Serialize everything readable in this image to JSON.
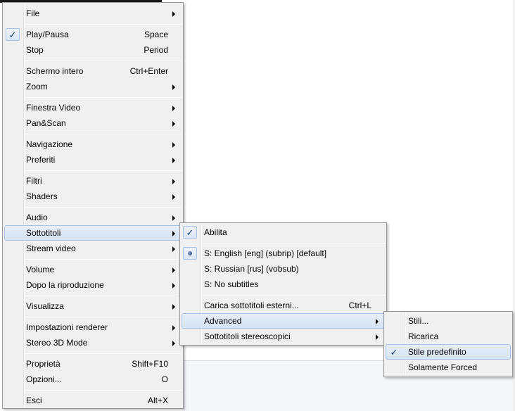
{
  "main_menu": {
    "items": [
      {
        "label": "File",
        "submenu": true
      },
      {
        "label": "Play/Pausa",
        "shortcut": "Space",
        "checked": true
      },
      {
        "label": "Stop",
        "shortcut": "Period"
      },
      {
        "label": "Schermo intero",
        "shortcut": "Ctrl+Enter"
      },
      {
        "label": "Zoom",
        "submenu": true
      },
      {
        "label": "Finestra Video",
        "submenu": true
      },
      {
        "label": "Pan&Scan",
        "submenu": true
      },
      {
        "label": "Navigazione",
        "submenu": true
      },
      {
        "label": "Preferiti",
        "submenu": true
      },
      {
        "label": "Filtri",
        "submenu": true
      },
      {
        "label": "Shaders",
        "submenu": true
      },
      {
        "label": "Audio",
        "submenu": true
      },
      {
        "label": "Sottotitoli",
        "submenu": true,
        "highlighted": true
      },
      {
        "label": "Stream video",
        "submenu": true
      },
      {
        "label": "Volume",
        "submenu": true
      },
      {
        "label": "Dopo la riproduzione",
        "submenu": true
      },
      {
        "label": "Visualizza",
        "submenu": true
      },
      {
        "label": "Impostazioni renderer",
        "submenu": true
      },
      {
        "label": "Stereo 3D Mode",
        "submenu": true
      },
      {
        "label": "Proprietà",
        "shortcut": "Shift+F10"
      },
      {
        "label": "Opzioni...",
        "shortcut": "O"
      },
      {
        "label": "Esci",
        "shortcut": "Alt+X"
      }
    ]
  },
  "subtitles_menu": {
    "items": [
      {
        "label": "Abilita",
        "checked": true
      },
      {
        "label": "S: English [eng] (subrip) [default]",
        "selected_radio": true
      },
      {
        "label": "S: Russian [rus] (vobsub)"
      },
      {
        "label": "S: No subtitles"
      },
      {
        "label": "Carica sottotitoli esterni...",
        "shortcut": "Ctrl+L"
      },
      {
        "label": "Advanced",
        "submenu": true,
        "highlighted": true
      },
      {
        "label": "Sottotitoli stereoscopici",
        "submenu": true
      }
    ]
  },
  "advanced_menu": {
    "items": [
      {
        "label": "Stili..."
      },
      {
        "label": "Ricarica"
      },
      {
        "label": "Stile predefinito",
        "checked": true,
        "highlighted": true
      },
      {
        "label": "Solamente Forced"
      }
    ]
  },
  "icons": {
    "check": "checkmark-icon",
    "radio": "radio-dot-icon",
    "submenu": "submenu-arrow-icon"
  },
  "colors": {
    "menu_bg": "#f0f0f0",
    "highlight_bg": "#d6e3f4",
    "highlight_border": "#a8c2e8"
  }
}
